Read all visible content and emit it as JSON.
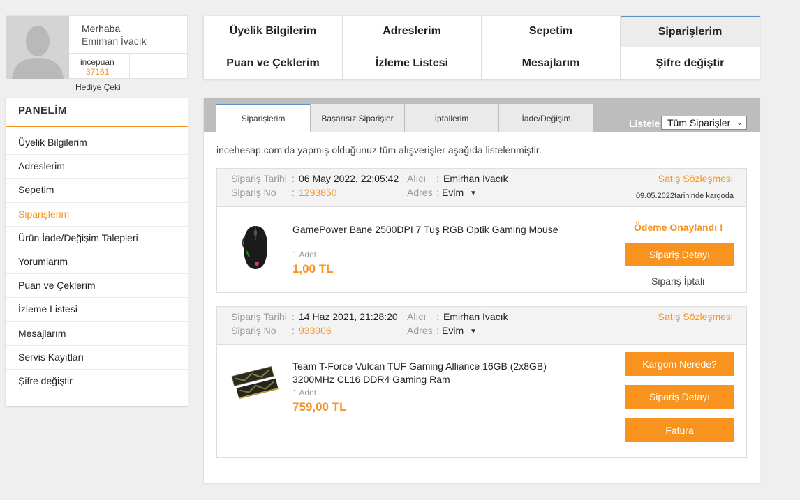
{
  "profile": {
    "greeting": "Merhaba",
    "name": "Emirhan İvacık",
    "points_label": "incepuan",
    "points_value": "37161",
    "gift_label": "Hediye Çeki"
  },
  "sidebar": {
    "title": "PANELİM",
    "items": [
      {
        "label": "Üyelik Bilgilerim"
      },
      {
        "label": "Adreslerim"
      },
      {
        "label": "Sepetim"
      },
      {
        "label": "Siparişlerim",
        "active": true
      },
      {
        "label": "Ürün İade/Değişim Talepleri"
      },
      {
        "label": "Yorumlarım"
      },
      {
        "label": "Puan ve Çeklerim"
      },
      {
        "label": "İzleme Listesi"
      },
      {
        "label": "Mesajlarım"
      },
      {
        "label": "Servis Kayıtları"
      },
      {
        "label": "Şifre değiştir"
      }
    ]
  },
  "topnav": [
    {
      "label": "Üyelik Bilgilerim"
    },
    {
      "label": "Adreslerim"
    },
    {
      "label": "Sepetim"
    },
    {
      "label": "Siparişlerim",
      "active": true
    },
    {
      "label": "Puan ve Çeklerim"
    },
    {
      "label": "İzleme Listesi"
    },
    {
      "label": "Mesajlarım"
    },
    {
      "label": "Şifre değiştir"
    }
  ],
  "tabs": [
    {
      "label": "Siparişlerim",
      "active": true
    },
    {
      "label": "Başarısız Siparişler"
    },
    {
      "label": "İptallerim"
    },
    {
      "label": "İade/Değişim"
    }
  ],
  "filter": {
    "label": "Listele",
    "selected": "Tüm Siparişler"
  },
  "info_text": "incehesap.com'da yapmış olduğunuz tüm alışverişler aşağıda listelenmiştir.",
  "labels": {
    "order_date": "Sipariş Tarihi",
    "order_no": "Sipariş No",
    "recipient": "Alıcı",
    "address": "Adres",
    "colon": ":"
  },
  "orders": [
    {
      "date": "06 May 2022, 22:05:42",
      "number": "1293850",
      "recipient": "Emirhan İvacık",
      "address": "Evim",
      "contract": "Satış Sözleşmesi",
      "cargo_note": "09.05.2022tarihinde kargoda",
      "product": "GamePower Bane 2500DPI 7 Tuş RGB Optik Gaming Mouse",
      "qty": "1 Adet",
      "price": "1,00 TL",
      "status": "Ödeme Onaylandı !",
      "detail_button": "Sipariş Detayı",
      "cancel_link": "Sipariş İptali"
    },
    {
      "date": "14 Haz 2021, 21:28:20",
      "number": "933906",
      "recipient": "Emirhan İvacık",
      "address": "Evim",
      "contract": "Satış Sözleşmesi",
      "product_line1": "Team T-Force Vulcan TUF Gaming Alliance 16GB (2x8GB)",
      "product_line2": "3200MHz CL16 DDR4 Gaming Ram",
      "qty": "1 Adet",
      "price": "759,00 TL",
      "cargo_button": "Kargom Nerede?",
      "detail_button": "Sipariş Detayı",
      "invoice_button": "Fatura"
    }
  ],
  "colors": {
    "accent": "#f7931e",
    "tab_bar": "#bdbdbd",
    "page_bg": "#efefef"
  }
}
